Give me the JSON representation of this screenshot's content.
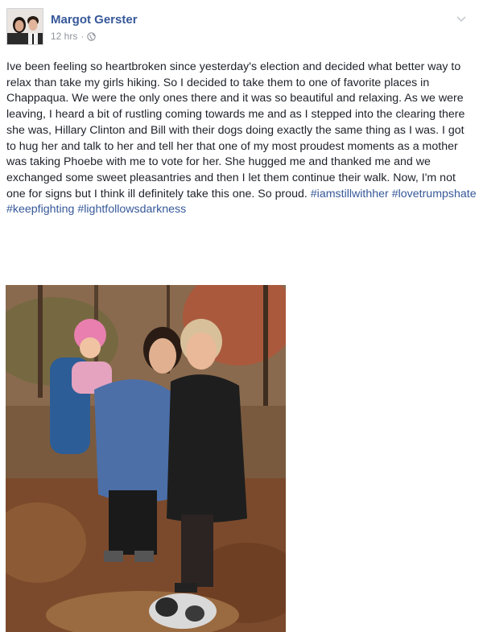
{
  "post": {
    "author": "Margot Gerster",
    "timestamp": "12 hrs",
    "body": "Ive been feeling so heartbroken since yesterday's election and decided what better way to relax than take my girls hiking. So I decided to take them to one of favorite places in Chappaqua. We were the only ones there and it was so beautiful and relaxing. As we were leaving, I heard a bit of rustling coming towards me and as I stepped into the clearing there she was, Hillary Clinton and Bill with their dogs doing exactly the same thing as I was. I got to hug her and talk to her and tell her that one of my most proudest moments as a mother was taking Phoebe with me to vote for her. She hugged me and thanked me and we exchanged some sweet pleasantries and then I let them continue their walk. Now, I'm not one for signs but I think ill definitely take this one. So proud.",
    "hashtags": [
      "#iamstillwithher",
      "#lovetrumpshate",
      "#keepfighting",
      "#lightfollowsdarkness"
    ],
    "privacy_icon": "globe-icon",
    "menu_icon": "chevron-down-icon"
  },
  "colors": {
    "link": "#365899",
    "text": "#1d2129",
    "meta": "#90949c"
  }
}
